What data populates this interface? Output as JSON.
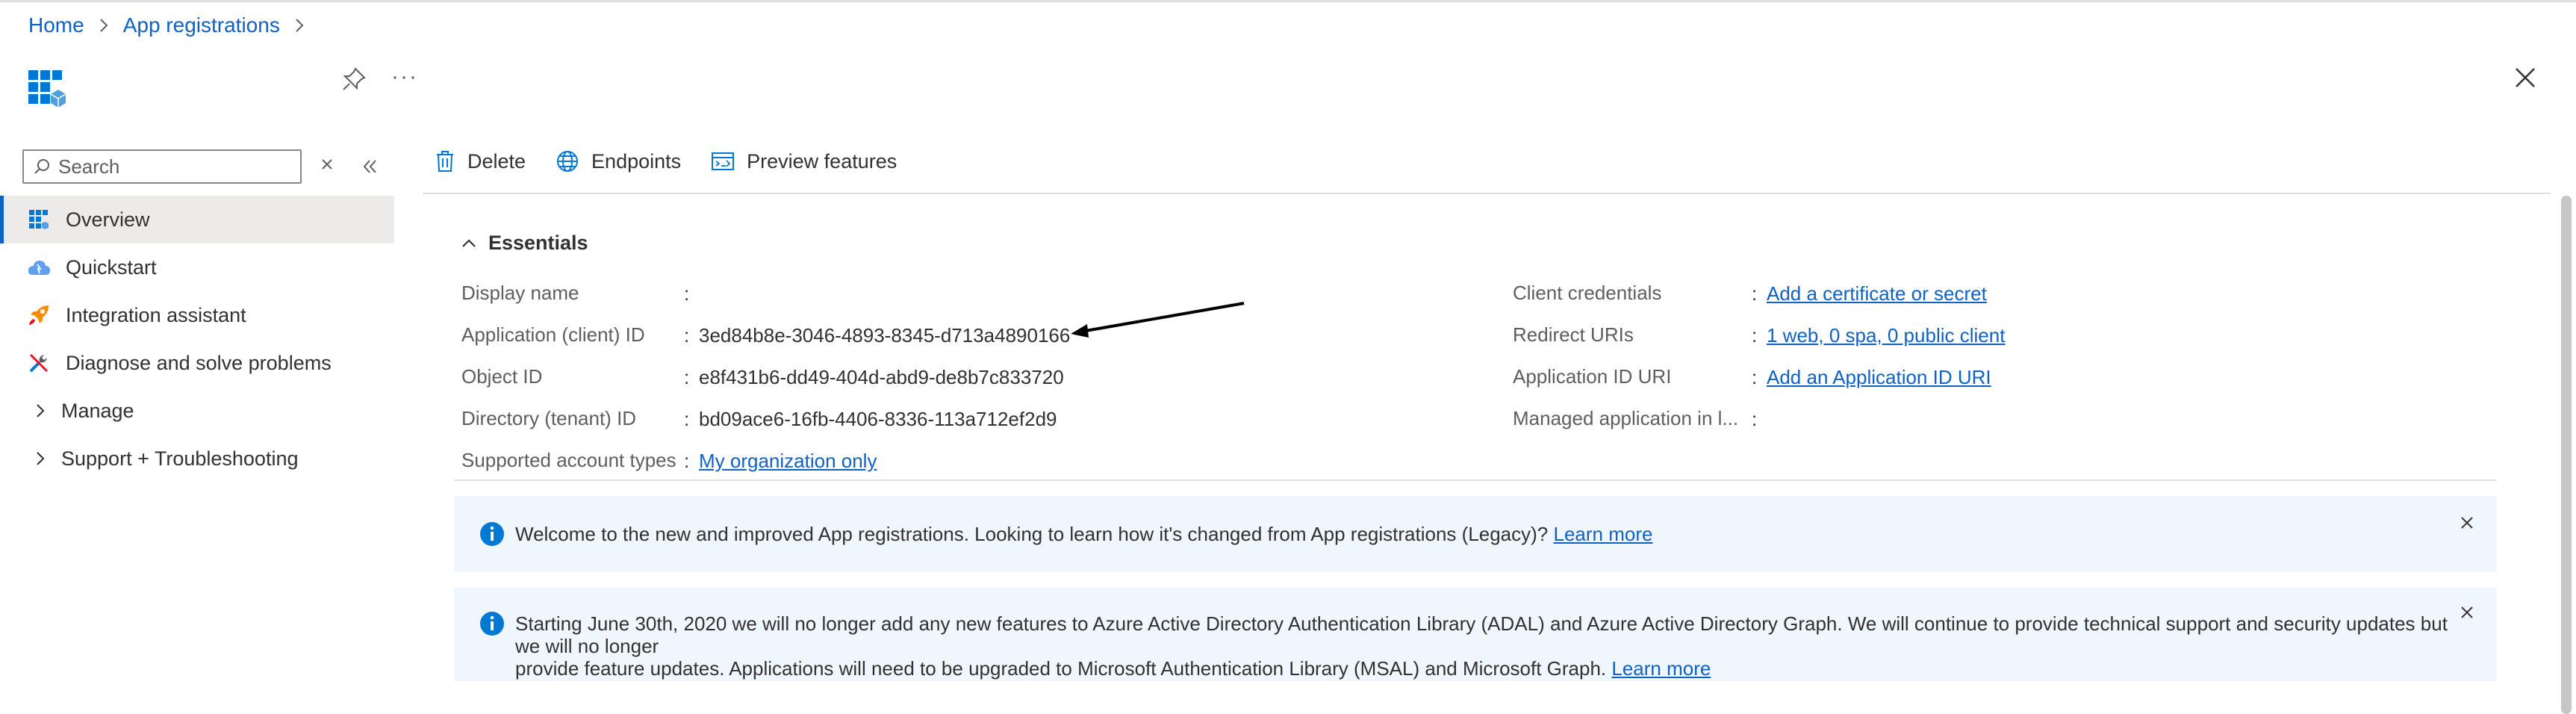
{
  "breadcrumb": {
    "home": "Home",
    "app_registrations": "App registrations"
  },
  "header": {
    "more": "···"
  },
  "sidebar": {
    "search_placeholder": "Search",
    "items": [
      {
        "label": "Overview",
        "icon": "overview-grid-icon",
        "active": true
      },
      {
        "label": "Quickstart",
        "icon": "cloud-quickstart-icon"
      },
      {
        "label": "Integration assistant",
        "icon": "rocket-icon"
      },
      {
        "label": "Diagnose and solve problems",
        "icon": "wrench-icon"
      },
      {
        "label": "Manage",
        "icon": "chevron-right-icon"
      },
      {
        "label": "Support + Troubleshooting",
        "icon": "chevron-right-icon"
      }
    ]
  },
  "toolbar": {
    "delete": "Delete",
    "endpoints": "Endpoints",
    "preview": "Preview features"
  },
  "essentials": {
    "title": "Essentials",
    "left": [
      {
        "label": "Display name",
        "value": ""
      },
      {
        "label": "Application (client) ID",
        "value": "3ed84b8e-3046-4893-8345-d713a4890166"
      },
      {
        "label": "Object ID",
        "value": "e8f431b6-dd49-404d-abd9-de8b7c833720"
      },
      {
        "label": "Directory (tenant) ID",
        "value": "bd09ace6-16fb-4406-8336-113a712ef2d9"
      },
      {
        "label": "Supported account types",
        "value": "My organization only"
      }
    ],
    "right": [
      {
        "label": "Client credentials",
        "value": "Add a certificate or secret"
      },
      {
        "label": "Redirect URIs",
        "value": "1 web, 0 spa, 0 public client"
      },
      {
        "label": "Application ID URI",
        "value": "Add an Application ID URI"
      },
      {
        "label": "Managed application in l...",
        "value": ""
      }
    ],
    "colon": ":"
  },
  "banners": [
    {
      "text": "Welcome to the new and improved App registrations. Looking to learn how it's changed from App registrations (Legacy)?",
      "link": "Learn more"
    },
    {
      "line1": "Starting June 30th, 2020 we will no longer add any new features to Azure Active Directory Authentication Library (ADAL) and Azure Active Directory Graph. We will continue to provide technical support and security updates but we will no longer",
      "line2": "provide feature updates. Applications will need to be upgraded to Microsoft Authentication Library (MSAL) and Microsoft Graph.",
      "link": "Learn more"
    }
  ],
  "colors": {
    "accent": "#0f62c4",
    "banner_bg": "#eff6fc",
    "active_bg": "#edebe9"
  }
}
